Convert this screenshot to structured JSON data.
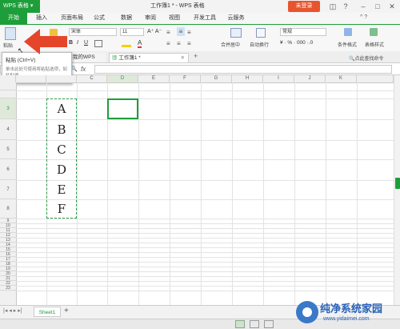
{
  "titlebar": {
    "app_label": "WPS 表格",
    "doc_title": "工作簿1 * - WPS 表格",
    "login_label": "未登录"
  },
  "tabs": [
    "开始",
    "插入",
    "页面布局",
    "公式",
    "数据",
    "审阅",
    "视图",
    "开发工具",
    "云服务"
  ],
  "ribbon": {
    "paste_label": "粘贴",
    "font_name": "宋体",
    "font_size": "11",
    "merge_label": "合并居中",
    "wrap_label": "自动换行",
    "number_format": "常规",
    "cond_format_label": "条件格式",
    "table_style_label": "表格样式"
  },
  "doctabs": {
    "my_wps": "我的WPS",
    "workbook": "工作簿1 *",
    "find_cmd": "点此查找命令"
  },
  "tooltip": {
    "title": "粘贴 (Ctrl+V)",
    "body": "单击此处可使用将粘贴选项，如粘贴值。"
  },
  "formula": {
    "fx": "fx"
  },
  "columns": [
    "C",
    "D",
    "E",
    "F",
    "G",
    "H",
    "I",
    "J",
    "K"
  ],
  "rows": [
    "3",
    "4",
    "5",
    "6",
    "7",
    "8",
    "9",
    "10",
    "11",
    "12",
    "13",
    "14",
    "15",
    "16",
    "17",
    "18",
    "19",
    "20",
    "21",
    "22",
    "23"
  ],
  "cells": [
    "A",
    "B",
    "C",
    "D",
    "E",
    "F"
  ],
  "sheets": [
    "Sheet1"
  ],
  "watermark": {
    "cn": "纯净系统家园",
    "url": "www.yidaimei.com"
  },
  "colors": {
    "accent": "#1e9e3a",
    "login": "#e8542e",
    "arrow": "#e5452a"
  }
}
